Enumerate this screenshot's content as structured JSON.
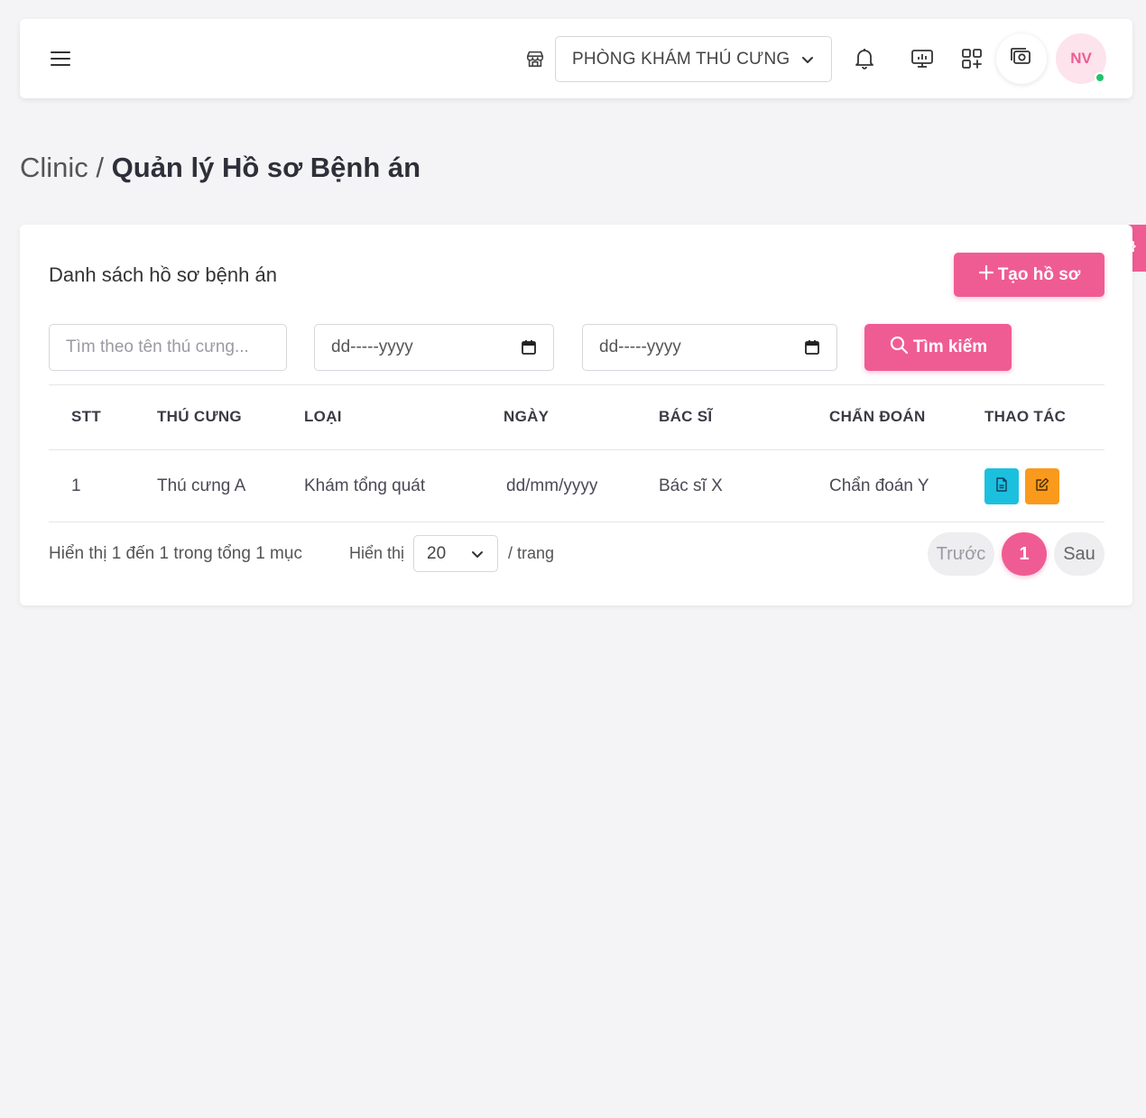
{
  "topbar": {
    "clinic_name": "PHÒNG KHÁM THÚ CƯNG",
    "avatar_initials": "NV",
    "icons": [
      "menu-icon",
      "store-icon",
      "chevron-down-icon",
      "bell-icon",
      "monitor-icon",
      "apps-add-icon",
      "camera-icon"
    ]
  },
  "breadcrumb": {
    "root": "Clinic",
    "separator": " / ",
    "current": "Quản lý Hồ sơ Bệnh án"
  },
  "card": {
    "title": "Danh sách hồ sơ bệnh án",
    "create_label": "Tạo hồ sơ"
  },
  "filters": {
    "search_placeholder": "Tìm theo tên thú cưng...",
    "date_from_placeholder": "dd-----yyyy",
    "date_to_placeholder": "dd-----yyyy",
    "search_label": "Tìm kiếm"
  },
  "table": {
    "headers": [
      "STT",
      "THÚ CƯNG",
      "LOẠI",
      "NGÀY",
      "BÁC SĨ",
      "CHẨN ĐOÁN",
      "THAO TÁC"
    ],
    "rows": [
      {
        "stt": "1",
        "pet": "Thú cưng A",
        "type": "Khám tổng quát",
        "date": "dd/mm/yyyy",
        "doctor": "Bác sĩ X",
        "diagnosis": "Chẩn đoán Y"
      }
    ]
  },
  "pagination": {
    "summary": "Hiển thị 1 đến 1 trong tổng 1 mục",
    "show_label": "Hiển thị",
    "page_size": "20",
    "per_page_label": "/ trang",
    "prev_label": "Trước",
    "current_page": "1",
    "next_label": "Sau"
  },
  "colors": {
    "accent": "#ef5c93",
    "view_button": "#1cc0df",
    "edit_button": "#fa9a1c",
    "online": "#21c36b"
  }
}
